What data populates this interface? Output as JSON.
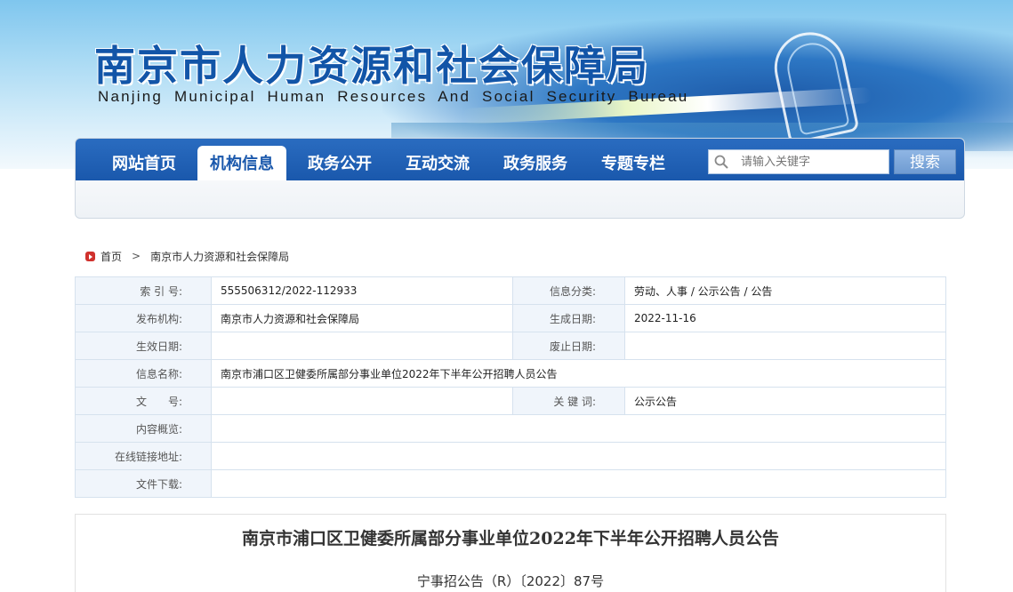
{
  "banner": {
    "title_cn": "南京市人力资源和社会保障局",
    "title_en": "Nanjing Municipal Human Resources And Social Security Bureau"
  },
  "nav": {
    "items": [
      {
        "label": "网站首页",
        "active": false
      },
      {
        "label": "机构信息",
        "active": true
      },
      {
        "label": "政务公开",
        "active": false
      },
      {
        "label": "互动交流",
        "active": false
      },
      {
        "label": "政务服务",
        "active": false
      },
      {
        "label": "专题专栏",
        "active": false
      }
    ],
    "search": {
      "placeholder": "请输入关键字",
      "button_label": "搜索"
    }
  },
  "breadcrumb": {
    "items": [
      "首页",
      "南京市人力资源和社会保障局"
    ],
    "separator": ">"
  },
  "info_table": {
    "index_label": "索 引 号:",
    "index_value": "555506312/2022-112933",
    "category_label": "信息分类:",
    "category_value": "劳动、人事 / 公示公告 / 公告",
    "publisher_label": "发布机构:",
    "publisher_value": "南京市人力资源和社会保障局",
    "created_label": "生成日期:",
    "created_value": "2022-11-16",
    "effective_label": "生效日期:",
    "effective_value": "",
    "abolished_label": "废止日期:",
    "abolished_value": "",
    "name_label": "信息名称:",
    "name_value": "南京市浦口区卫健委所属部分事业单位2022年下半年公开招聘人员公告",
    "docnum_label": "文　　号:",
    "docnum_value": "",
    "keywords_label": "关 键 词:",
    "keywords_value": "公示公告",
    "summary_label": "内容概览:",
    "summary_value": "",
    "link_label": "在线链接地址:",
    "link_value": "",
    "download_label": "文件下载:",
    "download_value": ""
  },
  "article": {
    "title": "南京市浦口区卫健委所属部分事业单位2022年下半年公开招聘人员公告",
    "doc_number": "宁事招公告（R）〔2022〕87号"
  },
  "colors": {
    "nav_blue": "#1a58ac",
    "title_blue": "#1255a8",
    "label_bg": "#f0f5fb"
  }
}
